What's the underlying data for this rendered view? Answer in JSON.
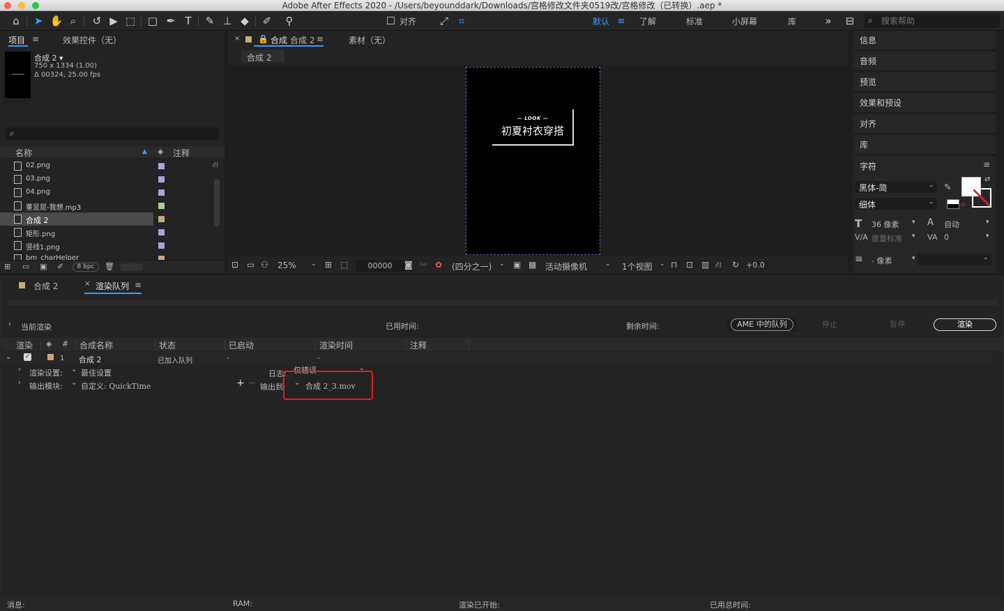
{
  "window": {
    "title": "Adobe After Effects 2020 - /Users/beyounddark/Downloads/宫格修改文件夹0519改/宫格修改（已转换）.aep *"
  },
  "toolbar": {
    "align_label": "对齐",
    "workspaces": [
      "默认",
      "了解",
      "标准",
      "小屏幕",
      "库"
    ],
    "search_placeholder": "搜索帮助"
  },
  "project": {
    "tab_project": "项目",
    "tab_effects": "效果控件（无）",
    "comp_name": "合成 2 ▾",
    "comp_size": "750 x 1334 (1.00)",
    "comp_duration": "Δ 00324, 25.00 fps",
    "col_name": "名称",
    "col_comment": "注释",
    "files": [
      {
        "name": "02.png",
        "color": "#a9a4e0",
        "selected": false
      },
      {
        "name": "03.png",
        "color": "#a9a4e0",
        "selected": false
      },
      {
        "name": "04.png",
        "color": "#a9a4e0",
        "selected": false
      },
      {
        "name": "董昱昆-我想.mp3",
        "color": "#a8d0a0",
        "selected": false
      },
      {
        "name": "合成 2",
        "color": "#c9a87a",
        "selected": true
      },
      {
        "name": "矩形.png",
        "color": "#a9a4e0",
        "selected": false
      },
      {
        "name": "竖线1.png",
        "color": "#a9a4e0",
        "selected": false
      },
      {
        "name": "bm_charHelper",
        "color": "#c9a87a",
        "selected": false
      }
    ],
    "bpc": "8 bpc"
  },
  "comp": {
    "tab_label": "合成",
    "tab_name": "合成 2",
    "footage_tab": "素材（无）",
    "sub_tab": "合成 2",
    "canvas_look": "— LOOK —",
    "canvas_text": "初夏衬衣穿搭",
    "zoom": "25%",
    "timecode": "00000",
    "resolution": "(四分之一)",
    "camera": "活动摄像机",
    "views": "1个视图",
    "exposure": "+0.0"
  },
  "right_panel": {
    "items": [
      "信息",
      "音频",
      "预览",
      "效果和预设",
      "对齐",
      "库"
    ],
    "character_title": "字符",
    "font": "黑体-简",
    "style": "细体",
    "size": "36 像素",
    "leading": "自动",
    "kerning": "度量标准",
    "tracking": "0",
    "indent_unit": "- 像素"
  },
  "render_queue": {
    "tab_comp": "合成 2",
    "tab_queue": "渲染队列",
    "current_render": "当前渲染",
    "elapsed_label": "已用时间:",
    "remaining_label": "剩余时间:",
    "ame_btn": "AME 中的队列",
    "stop_btn": "停止",
    "pause_btn": "暂停",
    "render_btn": "渲染",
    "columns": [
      "渲染",
      "#",
      "合成名称",
      "状态",
      "已启动",
      "渲染时间",
      "注释"
    ],
    "row": {
      "index": "1",
      "comp_name": "合成 2",
      "status": "已加入队列",
      "started": "-",
      "render_time": "-"
    },
    "render_settings_label": "渲染设置:",
    "render_settings_value": "最佳设置",
    "log_label": "日志:",
    "log_value": "仅错误",
    "output_module_label": "输出模块:",
    "output_module_value": "自定义: QuickTime",
    "output_to_label": "输出到:",
    "output_file": "合成 2_3.mov",
    "status_bar": {
      "message": "消息:",
      "ram": "RAM:",
      "render_started": "渲染已开始:",
      "total_time": "已用总时间:"
    }
  }
}
